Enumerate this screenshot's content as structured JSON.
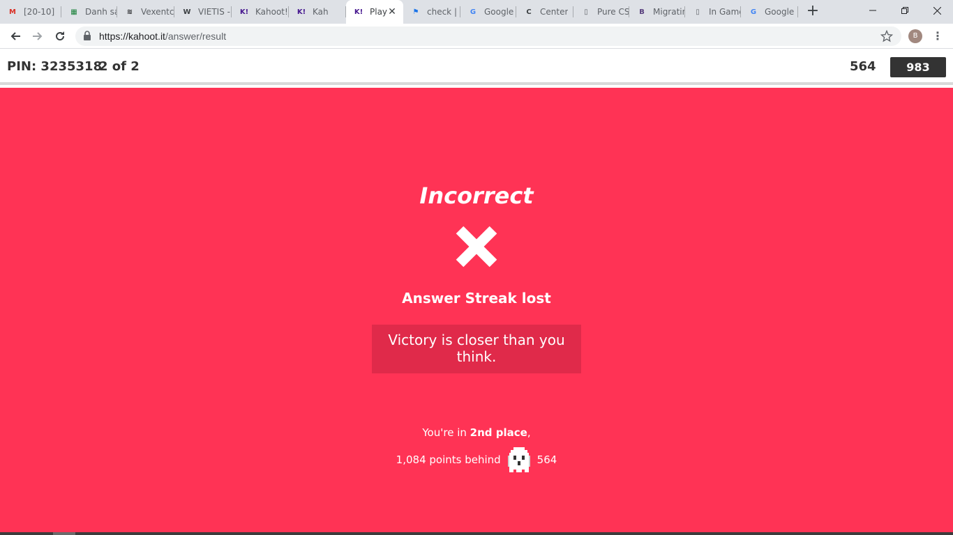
{
  "browser": {
    "tabs": [
      {
        "title": "[20-10]",
        "icon": "gmail-icon",
        "color": "#d93025",
        "glyph": "M"
      },
      {
        "title": "Danh sá",
        "icon": "sheets-icon",
        "color": "#188038",
        "glyph": "▦"
      },
      {
        "title": "Vexentc",
        "icon": "spotify-icon",
        "color": "#202124",
        "glyph": "≋"
      },
      {
        "title": "VIETIS -",
        "icon": "wordpress-icon",
        "color": "#3c4043",
        "glyph": "W"
      },
      {
        "title": "Kahoot!",
        "icon": "kahoot-icon",
        "color": "#46178f",
        "glyph": "K!"
      },
      {
        "title": "Kah",
        "icon": "kahoot-icon",
        "color": "#46178f",
        "glyph": "K!"
      },
      {
        "title": "Play",
        "icon": "kahoot-icon",
        "color": "#46178f",
        "glyph": "K!"
      },
      {
        "title": "check |",
        "icon": "flag-icon",
        "color": "#1a73e8",
        "glyph": "⚑"
      },
      {
        "title": "Google",
        "icon": "google-translate-icon",
        "color": "#4285f4",
        "glyph": "G"
      },
      {
        "title": "Center",
        "icon": "c-icon",
        "color": "#3c4043",
        "glyph": "C"
      },
      {
        "title": "Pure CS",
        "icon": "document-icon",
        "color": "#5f6368",
        "glyph": "▯"
      },
      {
        "title": "Migratin",
        "icon": "bootstrap-icon",
        "color": "#563d7c",
        "glyph": "B"
      },
      {
        "title": "In Game",
        "icon": "document-icon",
        "color": "#5f6368",
        "glyph": "▯"
      },
      {
        "title": "Google",
        "icon": "google-translate-icon",
        "color": "#4285f4",
        "glyph": "G"
      }
    ],
    "active_tab_index": 6,
    "url_host": "https://kahoot.it",
    "url_path": "/answer/result",
    "profile_initial": "B"
  },
  "game": {
    "pin_label": "PIN: 3235318",
    "question_count": "2 of 2",
    "score": "564",
    "nickname": "983"
  },
  "result": {
    "title": "Incorrect",
    "streak_text": "Answer Streak lost",
    "message": "Victory is closer than you think.",
    "place_prefix": "You're in ",
    "place_value": "2nd place",
    "place_suffix": ",",
    "behind_text": "1,084 points behind",
    "behind_score": "564",
    "accent_color": "#ff3355"
  }
}
